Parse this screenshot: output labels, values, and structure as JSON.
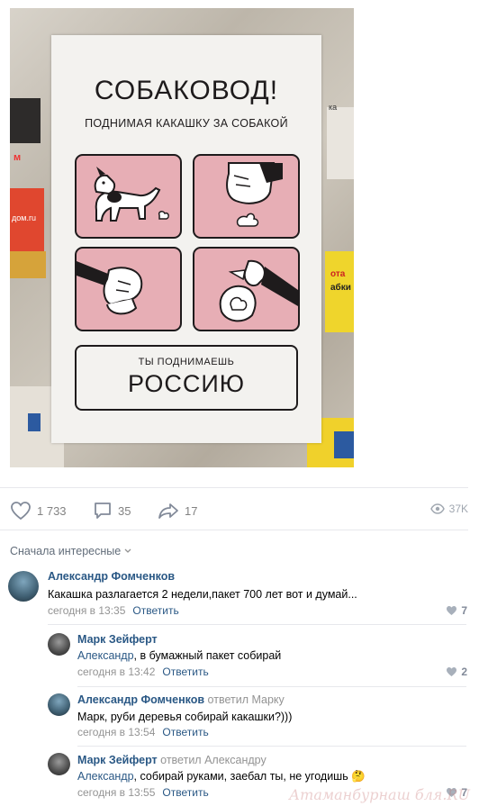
{
  "poster": {
    "title": "СОБАКОВОД!",
    "subtitle": "ПОДНИМАЯ КАКАШКУ ЗА СОБАКОЙ",
    "bottom_small": "ТЫ ПОДНИМАЕШЬ",
    "bottom_big": "РОССИЮ",
    "wall_fragments": [
      "дом.ru",
      "ка",
      "м",
      "ота",
      "абки"
    ]
  },
  "actions": {
    "likes": "1 733",
    "comments": "35",
    "shares": "17",
    "views": "37K"
  },
  "comments_section": {
    "sort_label": "Сначала интересные",
    "comments": [
      {
        "author": "Александр Фомченков",
        "replied_to": "",
        "mention": "",
        "text": "Какашка разлагается 2 недели,пакет 700 лет вот и думай...",
        "time": "сегодня в 13:35",
        "reply_label": "Ответить",
        "likes": "7"
      },
      {
        "author": "Марк Зейферт",
        "replied_to": "",
        "mention": "Александр",
        "text": ", в бумажный пакет собирай",
        "time": "сегодня в 13:42",
        "reply_label": "Ответить",
        "likes": "2"
      },
      {
        "author": "Александр Фомченков",
        "replied_to": "ответил Марку",
        "mention": "",
        "text": "Марк, руби деревья собирай какашки?)))",
        "time": "сегодня в 13:54",
        "reply_label": "Ответить",
        "likes": ""
      },
      {
        "author": "Марк Зейферт",
        "replied_to": "ответил Александру",
        "mention": "Александр",
        "text": ", собирай руками, заебал ты, не угодишь 🤔",
        "time": "сегодня в 13:55",
        "reply_label": "Ответить",
        "likes": "7"
      }
    ]
  },
  "watermark": "Атаманбурнаш бля.RU",
  "colors": {
    "link": "#2a5885",
    "muted": "#939393",
    "panel_pink": "#e7aeb5",
    "divider": "#e7e8ec"
  }
}
